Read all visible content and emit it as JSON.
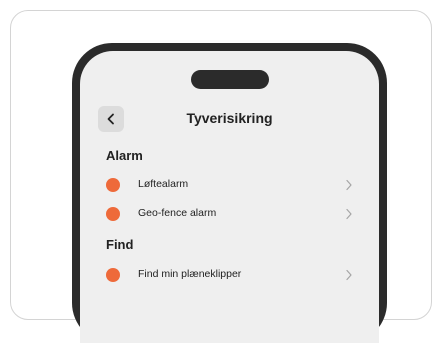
{
  "colors": {
    "accent": "#ee6a3a",
    "screen_bg": "#efefef",
    "phone_frame": "#2b2b2b"
  },
  "header": {
    "back_icon": "chevron-left-icon",
    "title": "Tyverisikring"
  },
  "sections": [
    {
      "title": "Alarm",
      "items": [
        {
          "label": "Løftealarm",
          "icon": "chevron-right-icon"
        },
        {
          "label": "Geo-fence alarm",
          "icon": "chevron-right-icon"
        }
      ]
    },
    {
      "title": "Find",
      "items": [
        {
          "label": "Find min plæneklipper",
          "icon": "chevron-right-icon"
        }
      ]
    }
  ]
}
